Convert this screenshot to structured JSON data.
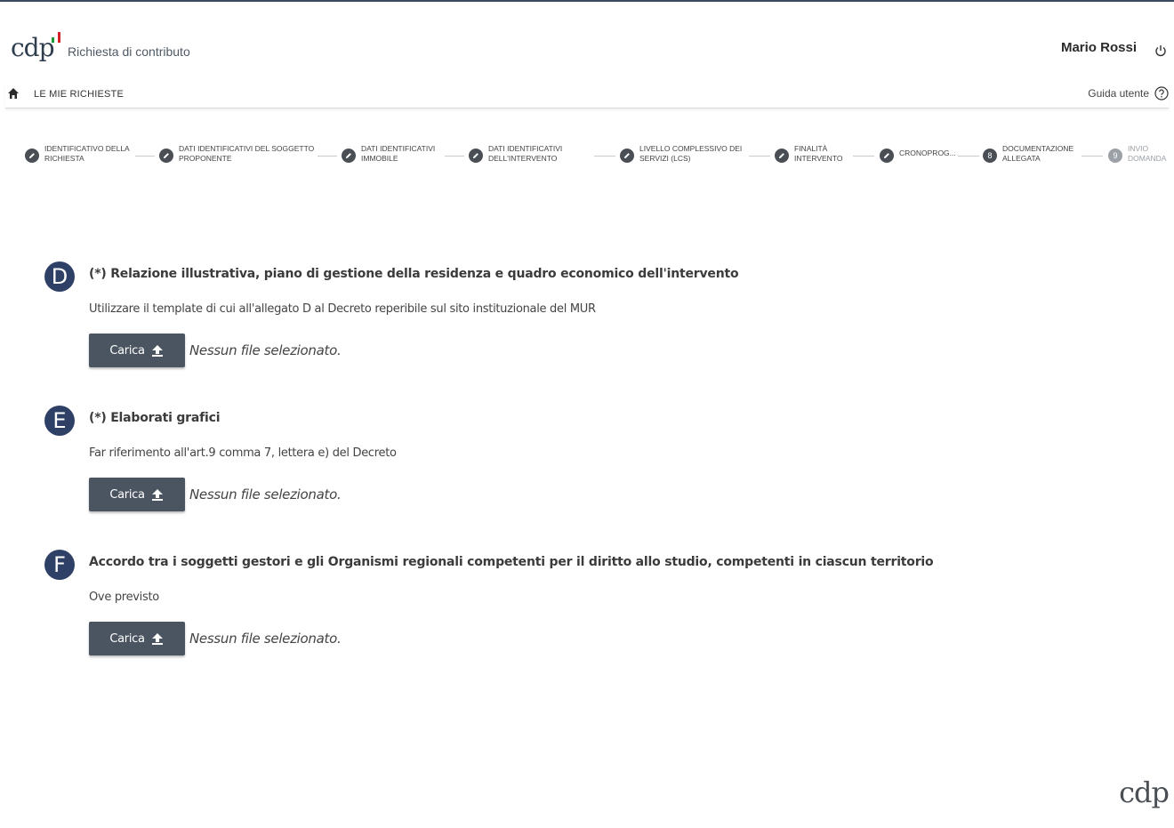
{
  "header": {
    "logo": "cdp",
    "app_title": "Richiesta di contributo",
    "user_name": "Mario Rossi"
  },
  "nav": {
    "home_link": "LE MIE RICHIESTE",
    "guide": "Guida utente"
  },
  "stepper": [
    {
      "label_1": "IDENTIFICATIVO DELLA",
      "label_2": "RICHIESTA",
      "state": "done"
    },
    {
      "label_1": "DATI IDENTIFICATIVI DEL SOGGETTO",
      "label_2": "PROPONENTE",
      "state": "done"
    },
    {
      "label_1": "DATI IDENTIFICATIVI",
      "label_2": "IMMOBILE",
      "state": "done"
    },
    {
      "label_1": "DATI IDENTIFICATIVI",
      "label_2": "DELL'INTERVENTO",
      "state": "done"
    },
    {
      "label_1": "LIVELLO COMPLESSIVO DEI",
      "label_2": "SERVIZI (LCS)",
      "state": "done"
    },
    {
      "label_1": "FINALITÀ",
      "label_2": "INTERVENTO",
      "state": "done"
    },
    {
      "label_1": "CRONOPROG...",
      "label_2": "",
      "state": "done"
    },
    {
      "number": "8",
      "label_1": "DOCUMENTAZIONE",
      "label_2": "ALLEGATA",
      "state": "current"
    },
    {
      "number": "9",
      "label_1": "INVIO",
      "label_2": "DOMANDA",
      "state": "todo"
    }
  ],
  "sections": [
    {
      "badge": "D",
      "title": "(*) Relazione illustrativa, piano di gestione della residenza e quadro economico dell'intervento",
      "description": "Utilizzare il template di cui all'allegato D al Decreto reperibile sul sito instituzionale del MUR",
      "button_label": "Carica",
      "file_status": "Nessun file selezionato."
    },
    {
      "badge": "E",
      "title": "(*) Elaborati grafici",
      "description": "Far riferimento all'art.9 comma 7, lettera e) del Decreto",
      "button_label": "Carica",
      "file_status": "Nessun file selezionato."
    },
    {
      "badge": "F",
      "title": "Accordo tra i soggetti gestori e gli Organismi regionali competenti per il diritto allo studio, competenti in ciascun territorio",
      "description": "Ove previsto",
      "button_label": "Carica",
      "file_status": "Nessun file selezionato."
    }
  ],
  "footer": {
    "logo": "cdp"
  }
}
